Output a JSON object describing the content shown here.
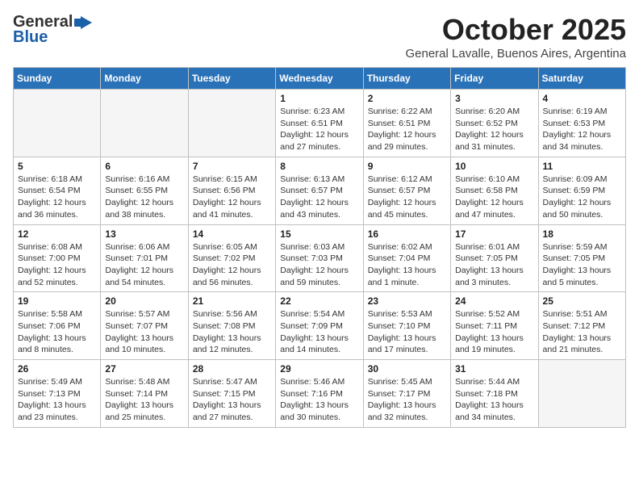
{
  "header": {
    "logo_general": "General",
    "logo_blue": "Blue",
    "month_title": "October 2025",
    "location": "General Lavalle, Buenos Aires, Argentina"
  },
  "days_of_week": [
    "Sunday",
    "Monday",
    "Tuesday",
    "Wednesday",
    "Thursday",
    "Friday",
    "Saturday"
  ],
  "weeks": [
    [
      {
        "day": "",
        "info": ""
      },
      {
        "day": "",
        "info": ""
      },
      {
        "day": "",
        "info": ""
      },
      {
        "day": "1",
        "info": "Sunrise: 6:23 AM\nSunset: 6:51 PM\nDaylight: 12 hours\nand 27 minutes."
      },
      {
        "day": "2",
        "info": "Sunrise: 6:22 AM\nSunset: 6:51 PM\nDaylight: 12 hours\nand 29 minutes."
      },
      {
        "day": "3",
        "info": "Sunrise: 6:20 AM\nSunset: 6:52 PM\nDaylight: 12 hours\nand 31 minutes."
      },
      {
        "day": "4",
        "info": "Sunrise: 6:19 AM\nSunset: 6:53 PM\nDaylight: 12 hours\nand 34 minutes."
      }
    ],
    [
      {
        "day": "5",
        "info": "Sunrise: 6:18 AM\nSunset: 6:54 PM\nDaylight: 12 hours\nand 36 minutes."
      },
      {
        "day": "6",
        "info": "Sunrise: 6:16 AM\nSunset: 6:55 PM\nDaylight: 12 hours\nand 38 minutes."
      },
      {
        "day": "7",
        "info": "Sunrise: 6:15 AM\nSunset: 6:56 PM\nDaylight: 12 hours\nand 41 minutes."
      },
      {
        "day": "8",
        "info": "Sunrise: 6:13 AM\nSunset: 6:57 PM\nDaylight: 12 hours\nand 43 minutes."
      },
      {
        "day": "9",
        "info": "Sunrise: 6:12 AM\nSunset: 6:57 PM\nDaylight: 12 hours\nand 45 minutes."
      },
      {
        "day": "10",
        "info": "Sunrise: 6:10 AM\nSunset: 6:58 PM\nDaylight: 12 hours\nand 47 minutes."
      },
      {
        "day": "11",
        "info": "Sunrise: 6:09 AM\nSunset: 6:59 PM\nDaylight: 12 hours\nand 50 minutes."
      }
    ],
    [
      {
        "day": "12",
        "info": "Sunrise: 6:08 AM\nSunset: 7:00 PM\nDaylight: 12 hours\nand 52 minutes."
      },
      {
        "day": "13",
        "info": "Sunrise: 6:06 AM\nSunset: 7:01 PM\nDaylight: 12 hours\nand 54 minutes."
      },
      {
        "day": "14",
        "info": "Sunrise: 6:05 AM\nSunset: 7:02 PM\nDaylight: 12 hours\nand 56 minutes."
      },
      {
        "day": "15",
        "info": "Sunrise: 6:03 AM\nSunset: 7:03 PM\nDaylight: 12 hours\nand 59 minutes."
      },
      {
        "day": "16",
        "info": "Sunrise: 6:02 AM\nSunset: 7:04 PM\nDaylight: 13 hours\nand 1 minute."
      },
      {
        "day": "17",
        "info": "Sunrise: 6:01 AM\nSunset: 7:05 PM\nDaylight: 13 hours\nand 3 minutes."
      },
      {
        "day": "18",
        "info": "Sunrise: 5:59 AM\nSunset: 7:05 PM\nDaylight: 13 hours\nand 5 minutes."
      }
    ],
    [
      {
        "day": "19",
        "info": "Sunrise: 5:58 AM\nSunset: 7:06 PM\nDaylight: 13 hours\nand 8 minutes."
      },
      {
        "day": "20",
        "info": "Sunrise: 5:57 AM\nSunset: 7:07 PM\nDaylight: 13 hours\nand 10 minutes."
      },
      {
        "day": "21",
        "info": "Sunrise: 5:56 AM\nSunset: 7:08 PM\nDaylight: 13 hours\nand 12 minutes."
      },
      {
        "day": "22",
        "info": "Sunrise: 5:54 AM\nSunset: 7:09 PM\nDaylight: 13 hours\nand 14 minutes."
      },
      {
        "day": "23",
        "info": "Sunrise: 5:53 AM\nSunset: 7:10 PM\nDaylight: 13 hours\nand 17 minutes."
      },
      {
        "day": "24",
        "info": "Sunrise: 5:52 AM\nSunset: 7:11 PM\nDaylight: 13 hours\nand 19 minutes."
      },
      {
        "day": "25",
        "info": "Sunrise: 5:51 AM\nSunset: 7:12 PM\nDaylight: 13 hours\nand 21 minutes."
      }
    ],
    [
      {
        "day": "26",
        "info": "Sunrise: 5:49 AM\nSunset: 7:13 PM\nDaylight: 13 hours\nand 23 minutes."
      },
      {
        "day": "27",
        "info": "Sunrise: 5:48 AM\nSunset: 7:14 PM\nDaylight: 13 hours\nand 25 minutes."
      },
      {
        "day": "28",
        "info": "Sunrise: 5:47 AM\nSunset: 7:15 PM\nDaylight: 13 hours\nand 27 minutes."
      },
      {
        "day": "29",
        "info": "Sunrise: 5:46 AM\nSunset: 7:16 PM\nDaylight: 13 hours\nand 30 minutes."
      },
      {
        "day": "30",
        "info": "Sunrise: 5:45 AM\nSunset: 7:17 PM\nDaylight: 13 hours\nand 32 minutes."
      },
      {
        "day": "31",
        "info": "Sunrise: 5:44 AM\nSunset: 7:18 PM\nDaylight: 13 hours\nand 34 minutes."
      },
      {
        "day": "",
        "info": ""
      }
    ]
  ]
}
